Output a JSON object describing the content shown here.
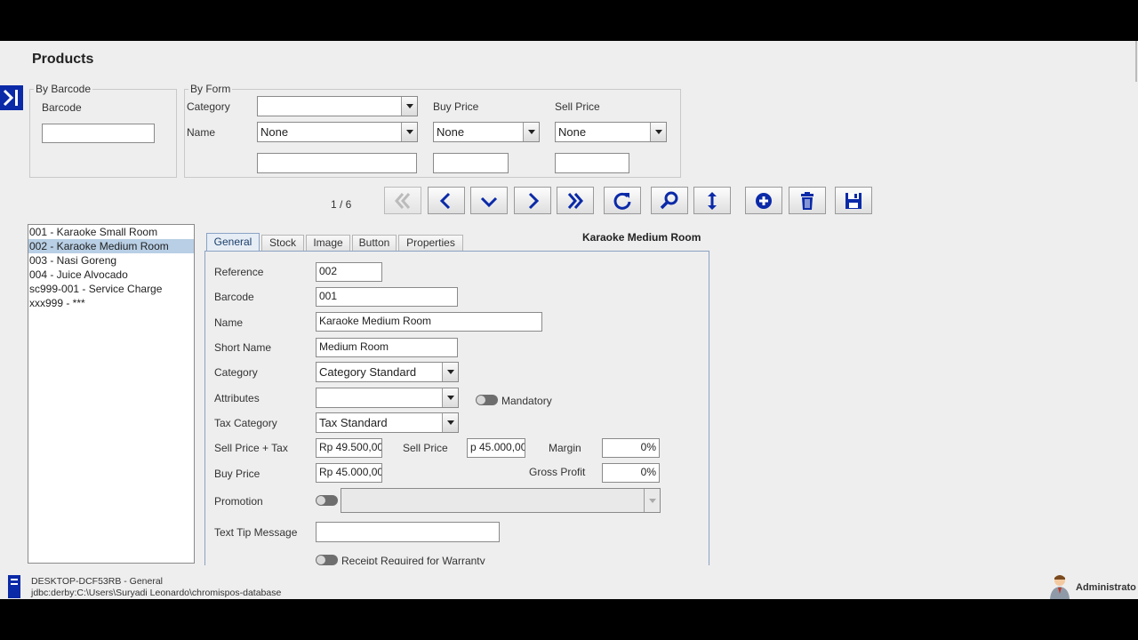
{
  "window": {
    "title": "Products"
  },
  "filters": {
    "by_barcode": {
      "legend": "By Barcode",
      "label": "Barcode",
      "value": ""
    },
    "by_form": {
      "legend": "By Form",
      "category_label": "Category",
      "category_value": "",
      "name_label": "Name",
      "name_op": "None",
      "name_value": "",
      "buy_price_label": "Buy Price",
      "buy_price_op": "None",
      "buy_price_value": "",
      "sell_price_label": "Sell Price",
      "sell_price_op": "None",
      "sell_price_value": ""
    }
  },
  "toolbar": {
    "page_indicator": "1 / 6",
    "buttons": [
      "first-icon",
      "previous-icon",
      "down-icon",
      "next-icon",
      "last-icon",
      "reload-icon",
      "search-icon",
      "sort-icon",
      "add-icon",
      "delete-icon",
      "save-icon"
    ]
  },
  "product_list": [
    "001 - Karaoke Small Room",
    "002 - Karaoke Medium Room",
    "003 - Nasi Goreng",
    "004 - Juice Alvocado",
    "sc999-001 - Service Charge",
    "xxx999 - ***"
  ],
  "selected_index": 1,
  "tabs": [
    "General",
    "Stock",
    "Image",
    "Button",
    "Properties"
  ],
  "active_tab": "General",
  "product_header": "Karaoke Medium Room",
  "form": {
    "reference_label": "Reference",
    "reference": "002",
    "barcode_label": "Barcode",
    "barcode": "001",
    "name_label": "Name",
    "name": "Karaoke Medium Room",
    "short_name_label": "Short Name",
    "short_name": "Medium Room",
    "category_label": "Category",
    "category": "Category Standard",
    "attributes_label": "Attributes",
    "attributes": "",
    "mandatory_label": "Mandatory",
    "tax_category_label": "Tax Category",
    "tax_category": "Tax Standard",
    "sell_price_tax_label": "Sell Price + Tax",
    "sell_price_tax": "Rp 49.500,00",
    "sell_price_label": "Sell Price",
    "sell_price": "p 45.000,00",
    "margin_label": "Margin",
    "margin": "0%",
    "buy_price_label": "Buy Price",
    "buy_price": "Rp 45.000,00",
    "gross_profit_label": "Gross Profit",
    "gross_profit": "0%",
    "promotion_label": "Promotion",
    "promotion": "",
    "text_tip_label": "Text Tip Message",
    "text_tip": "",
    "warranty_label": "Receipt Required for Warranty"
  },
  "status_bar": {
    "host": "DESKTOP-DCF53RB - General",
    "db": "jdbc:derby:C:\\Users\\Suryadi Leonardo\\chromispos-database",
    "user": "Administrato"
  },
  "colors": {
    "accent": "#0b2aa8",
    "selection": "#b8cfe5",
    "tab_border": "#8aa2c2"
  }
}
